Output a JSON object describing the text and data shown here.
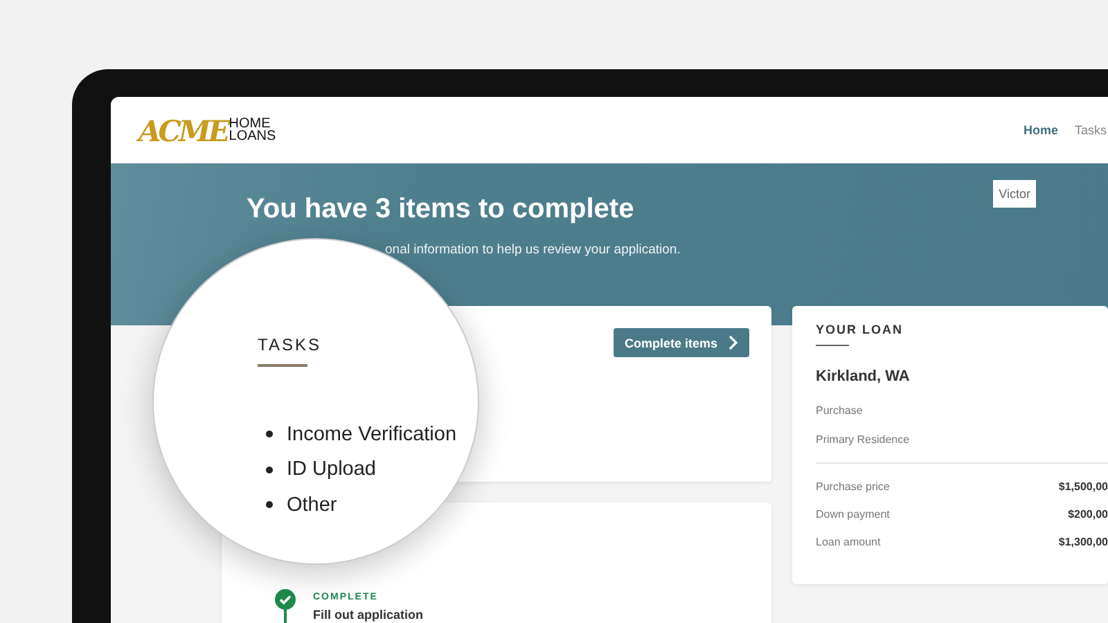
{
  "logo": {
    "mark": "ACME",
    "line_1": "HOME",
    "line_2": "LOANS"
  },
  "nav": [
    {
      "label": "Home",
      "selected": true
    },
    {
      "label": "Tasks",
      "selected": false
    }
  ],
  "user_button": "Victor",
  "banner": {
    "title": "You have 3 items to complete",
    "subtitle": "onal information to help us review your application."
  },
  "tasks_card": {
    "title": "TASKS",
    "button": "Complete items",
    "items": [
      "Income Verification",
      "ID Upload",
      "Other"
    ]
  },
  "timeline": [
    {
      "status": "COMPLETE",
      "label": "Fill out application",
      "complete": true
    }
  ],
  "loan_card": {
    "title": "YOUR LOAN",
    "location": "Kirkland, WA",
    "details": [
      "Purchase",
      "Primary Residence"
    ],
    "rows": [
      {
        "label": "Purchase price",
        "value": "$1,500,00"
      },
      {
        "label": "Down payment",
        "value": "$200,00"
      },
      {
        "label": "Loan amount",
        "value": "$1,300,00"
      }
    ]
  }
}
